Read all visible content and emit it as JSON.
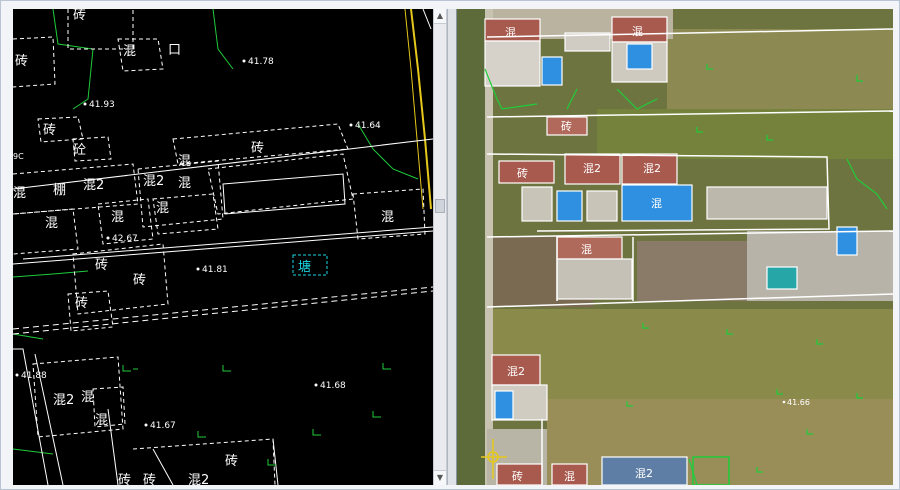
{
  "cad_map": {
    "elevations": [
      "41.78",
      "41.93",
      "41.64",
      "42.67",
      "41.81",
      "41.68",
      "41.67",
      "41.88"
    ],
    "material_labels": [
      "砖",
      "混",
      "混2",
      "砼",
      "棚",
      "混2",
      "混",
      "砖",
      "混",
      "混",
      "混2",
      "混",
      "混",
      "砖",
      "混",
      "砖",
      "砖",
      "砖",
      "塘",
      "混2",
      "混",
      "砖",
      "混2",
      "混",
      "混2",
      "砖",
      "混",
      "砖",
      "混2",
      "口",
      "9C",
      "砖"
    ]
  },
  "ortho_map": {
    "building_labels": [
      "混",
      "混",
      "砖",
      "砖",
      "混2",
      "混2",
      "混",
      "混",
      "混2",
      "砖",
      "混",
      "混2"
    ],
    "elevation": "41.66"
  },
  "colors": {
    "cad_line": "#ffffff",
    "cad_green": "#1fcc3a",
    "cad_cyan": "#19d6e6",
    "cad_yellow": "#e6c81a",
    "roof_blue": "#2f8fe0",
    "roof_red": "#a85a4e"
  }
}
